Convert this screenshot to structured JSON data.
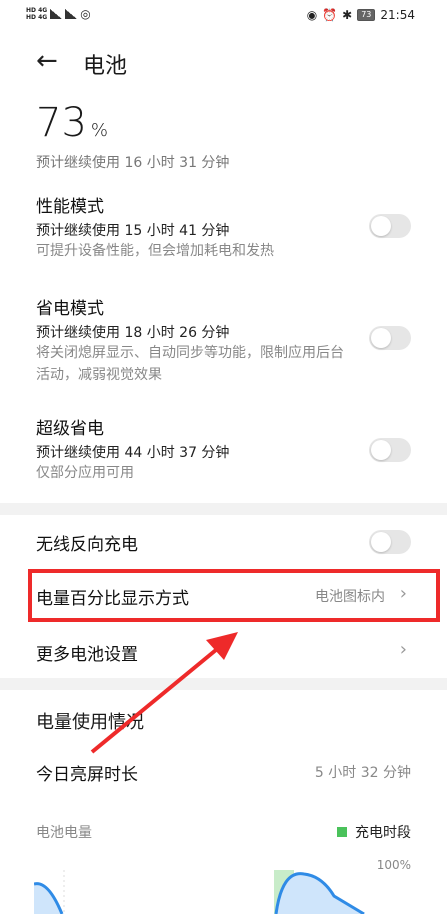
{
  "status": {
    "left_top": "HD 4G",
    "left_bottom": "HD 4G",
    "battery_level": "73",
    "time": "21:54"
  },
  "header": {
    "back_icon": "arrow-left-icon",
    "title": "电池"
  },
  "battery": {
    "percent": "73",
    "unit": "%",
    "remaining": "预计继续使用 16 小时 31 分钟"
  },
  "modes": [
    {
      "title": "性能模式",
      "estimate": "预计继续使用 15 小时 41 分钟",
      "desc": "可提升设备性能，但会增加耗电和发热",
      "enabled": false
    },
    {
      "title": "省电模式",
      "estimate": "预计继续使用 18 小时 26 分钟",
      "desc": "将关闭熄屏显示、自动同步等功能，限制应用后台活动，减弱视觉效果",
      "enabled": false
    },
    {
      "title": "超级省电",
      "estimate": "预计继续使用 44 小时 37 分钟",
      "desc": "仅部分应用可用",
      "enabled": false
    }
  ],
  "settings": {
    "wireless_reverse": {
      "label": "无线反向充电",
      "enabled": false
    },
    "percent_display": {
      "label": "电量百分比显示方式",
      "value": "电池图标内"
    },
    "more": {
      "label": "更多电池设置"
    }
  },
  "usage": {
    "title": "电量使用情况",
    "screen_time_label": "今日亮屏时长",
    "screen_time_value": "5 小时 32 分钟",
    "chart_label": "电池电量",
    "legend": "充电时段",
    "ymax": "100%"
  },
  "colors": {
    "accent_red": "#ee2a2a",
    "charge_green": "#4ac25b",
    "line_blue": "#2f8be6"
  }
}
